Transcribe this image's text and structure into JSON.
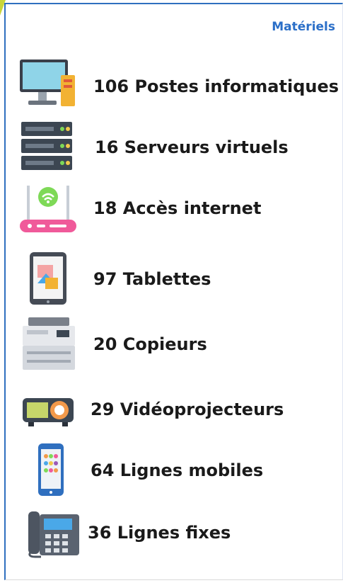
{
  "panel": {
    "title": "Matériels",
    "items": [
      {
        "icon": "desktop-computer-icon",
        "label": "106 Postes informatiques"
      },
      {
        "icon": "server-icon",
        "label": "16 Serveurs virtuels"
      },
      {
        "icon": "wifi-router-icon",
        "label": "18 Accès internet"
      },
      {
        "icon": "tablet-icon",
        "label": "97 Tablettes"
      },
      {
        "icon": "copier-icon",
        "label": "20 Copieurs"
      },
      {
        "icon": "projector-icon",
        "label": "29 Vidéoprojecteurs"
      },
      {
        "icon": "mobile-phone-icon",
        "label": "64 Lignes mobiles"
      },
      {
        "icon": "desk-phone-icon",
        "label": "36 Lignes fixes"
      }
    ]
  }
}
